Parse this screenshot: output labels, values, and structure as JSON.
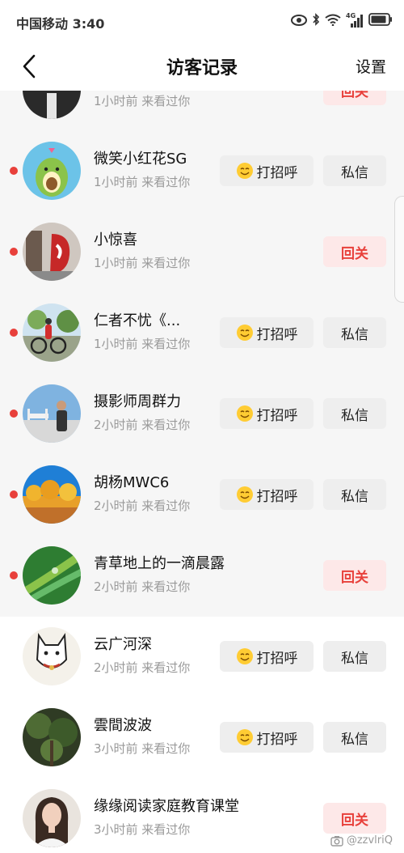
{
  "status_bar": {
    "carrier_time": "中国移动 3:40",
    "icons": [
      "eye-icon",
      "bluetooth-icon",
      "wifi-icon",
      "signal-4g-icon",
      "battery-icon"
    ],
    "network_label": "4G"
  },
  "nav": {
    "title": "访客记录",
    "settings_label": "设置"
  },
  "buttons": {
    "greet": "打招呼",
    "message": "私信",
    "follow_back": "回关"
  },
  "visitors": [
    {
      "name": "",
      "time": "1小时前 来看过你",
      "unread": false,
      "action": "follow_back"
    },
    {
      "name": "微笑小红花SG",
      "time": "1小时前 来看过你",
      "unread": true,
      "action": "greet"
    },
    {
      "name": "小惊喜",
      "time": "1小时前 来看过你",
      "unread": true,
      "action": "follow_back"
    },
    {
      "name": "仁者不忧《...",
      "time": "1小时前 来看过你",
      "unread": true,
      "action": "greet"
    },
    {
      "name": "摄影师周群力",
      "time": "2小时前 来看过你",
      "unread": true,
      "action": "greet"
    },
    {
      "name": "胡杨MWC6",
      "time": "2小时前 来看过你",
      "unread": true,
      "action": "greet"
    },
    {
      "name": "青草地上的一滴晨露",
      "time": "2小时前 来看过你",
      "unread": true,
      "action": "follow_back"
    },
    {
      "name": "云广河深",
      "time": "2小时前 来看过你",
      "unread": false,
      "action": "greet"
    },
    {
      "name": "雲間波波",
      "time": "3小时前 来看过你",
      "unread": false,
      "action": "greet"
    },
    {
      "name": "缘缘阅读家庭教育课堂",
      "time": "3小时前 来看过你",
      "unread": false,
      "action": "follow_back"
    }
  ],
  "watermark": "@zzvlriQ",
  "colors": {
    "accent_red": "#e8403b",
    "follow_bg": "#fde8e8",
    "button_bg": "#eeeeee",
    "unread_row_bg": "#f6f6f6"
  }
}
